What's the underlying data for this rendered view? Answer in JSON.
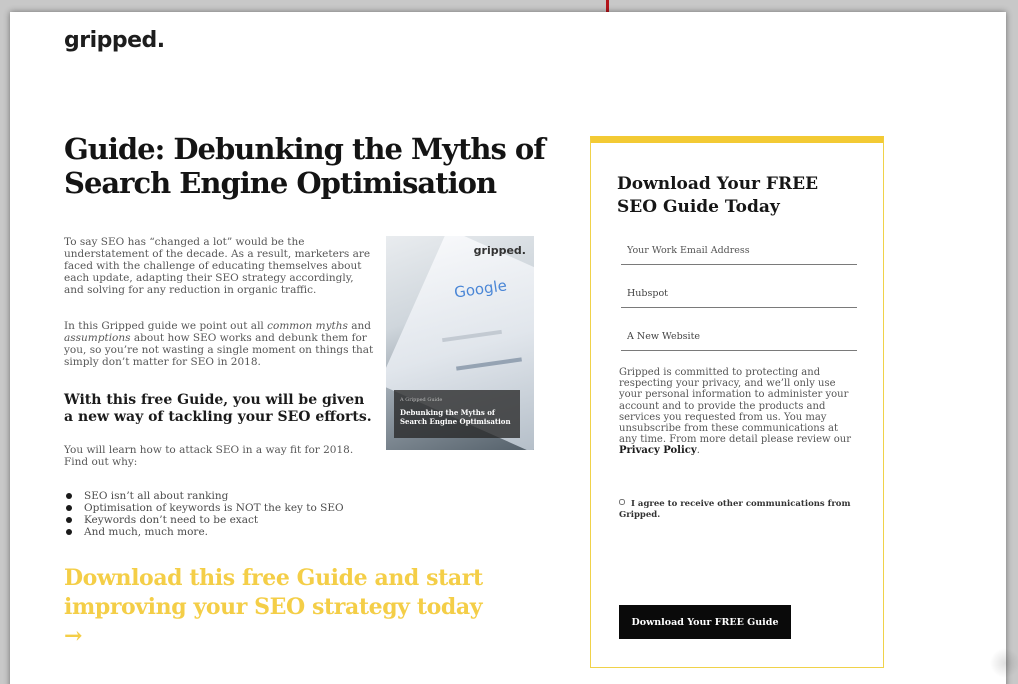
{
  "brand": {
    "logo": "gripped.",
    "accent": "#f3ca34",
    "cta_color": "#f4ce47",
    "arrow_color": "#b3151b"
  },
  "hero": {
    "headline": "Guide: Debunking the Myths of Search Engine Optimisation",
    "intro": "To say SEO has “changed a lot” would be the understatement of the decade. As a result, marketers are faced with the challenge of educating themselves about each update, adapting their SEO strategy accordingly, and solving for any reduction in organic traffic.",
    "intro2_a": "In this Gripped guide we point out all ",
    "intro2_em1": "common myths",
    "intro2_b": " and ",
    "intro2_em2": "assumptions",
    "intro2_c": " about how SEO works and debunk them for you, so you’re not wasting a single moment on things that simply don’t matter for SEO in 2018.",
    "subhead": "With this free Guide, you will be given a new way of tackling your SEO efforts.",
    "learn": "You will learn how to attack SEO in a way fit for 2018. Find out why:",
    "bullets": [
      "SEO isn’t all about ranking",
      "Optimisation of keywords is NOT the key to SEO",
      "Keywords don’t need to be exact",
      "And much, much more."
    ],
    "cta": "Download this free Guide and start improving your SEO strategy today →"
  },
  "cover": {
    "logo": "gripped.",
    "google": "Google",
    "tag": "A Gripped Guide",
    "title": "Debunking the Myths of Search Engine Optimisation"
  },
  "form": {
    "title": "Download Your FREE SEO Guide Today",
    "fields": [
      {
        "placeholder": "Your Work Email Address",
        "value": ""
      },
      {
        "placeholder": "",
        "value": "Hubspot"
      },
      {
        "placeholder": "",
        "value": "A New Website"
      }
    ],
    "privacy": "Gripped is committed to protecting and respecting your privacy, and we’ll only use your personal information to administer your account and to provide the products and services you requested from us. You may unsubscribe from these communications at any time. From more detail please review our ",
    "privacy_link": "Privacy Policy",
    "privacy_end": ".",
    "consent": "I agree to receive other communications from Gripped.",
    "submit": "Download Your FREE Guide"
  }
}
